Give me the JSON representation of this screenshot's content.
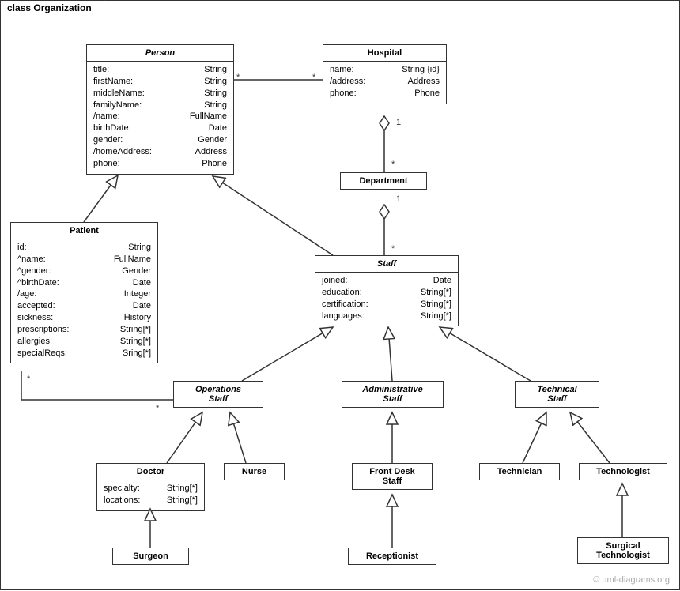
{
  "frame": {
    "label": "class Organization"
  },
  "classes": {
    "person": {
      "name": "Person",
      "attrs": [
        [
          "title:",
          "String"
        ],
        [
          "firstName:",
          "String"
        ],
        [
          "middleName:",
          "String"
        ],
        [
          "familyName:",
          "String"
        ],
        [
          "/name:",
          "FullName"
        ],
        [
          "birthDate:",
          "Date"
        ],
        [
          "gender:",
          "Gender"
        ],
        [
          "/homeAddress:",
          "Address"
        ],
        [
          "phone:",
          "Phone"
        ]
      ]
    },
    "hospital": {
      "name": "Hospital",
      "attrs": [
        [
          "name:",
          "String {id}"
        ],
        [
          "/address:",
          "Address"
        ],
        [
          "phone:",
          "Phone"
        ]
      ]
    },
    "department": {
      "name": "Department"
    },
    "patient": {
      "name": "Patient",
      "attrs": [
        [
          "id:",
          "String"
        ],
        [
          "^name:",
          "FullName"
        ],
        [
          "^gender:",
          "Gender"
        ],
        [
          "^birthDate:",
          "Date"
        ],
        [
          "/age:",
          "Integer"
        ],
        [
          "accepted:",
          "Date"
        ],
        [
          "sickness:",
          "History"
        ],
        [
          "prescriptions:",
          "String[*]"
        ],
        [
          "allergies:",
          "String[*]"
        ],
        [
          "specialReqs:",
          "Sring[*]"
        ]
      ]
    },
    "staff": {
      "name": "Staff",
      "attrs": [
        [
          "joined:",
          "Date"
        ],
        [
          "education:",
          "String[*]"
        ],
        [
          "certification:",
          "String[*]"
        ],
        [
          "languages:",
          "String[*]"
        ]
      ]
    },
    "opsStaff": {
      "name_l1": "Operations",
      "name_l2": "Staff"
    },
    "adminStaff": {
      "name_l1": "Administrative",
      "name_l2": "Staff"
    },
    "techStaff": {
      "name_l1": "Technical",
      "name_l2": "Staff"
    },
    "doctor": {
      "name": "Doctor",
      "attrs": [
        [
          "specialty:",
          "String[*]"
        ],
        [
          "locations:",
          "String[*]"
        ]
      ]
    },
    "nurse": {
      "name": "Nurse"
    },
    "frontDesk": {
      "name_l1": "Front Desk",
      "name_l2": "Staff"
    },
    "technician": {
      "name": "Technician"
    },
    "technologist": {
      "name": "Technologist"
    },
    "surgeon": {
      "name": "Surgeon"
    },
    "receptionist": {
      "name": "Receptionist"
    },
    "surgTech": {
      "name_l1": "Surgical",
      "name_l2": "Technologist"
    }
  },
  "mult": {
    "star1": "*",
    "star2": "*",
    "star3": "*",
    "star4": "*",
    "star5": "*",
    "one1": "1",
    "one2": "1"
  },
  "watermark": "© uml-diagrams.org"
}
